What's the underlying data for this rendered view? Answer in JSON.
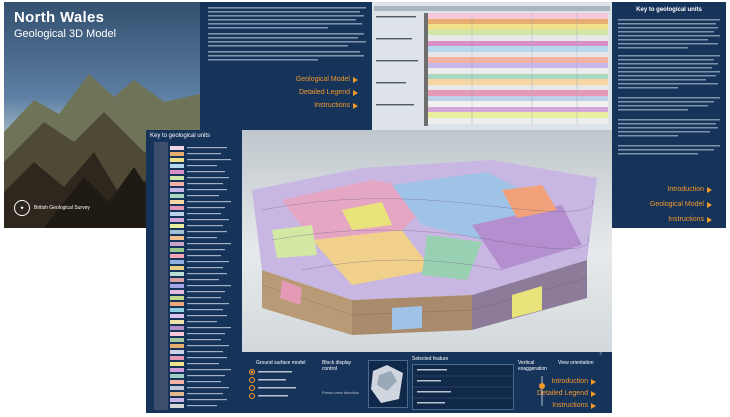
{
  "cover": {
    "title": "North Wales",
    "subtitle": "Geological 3D Model",
    "org_name": "British Geological Survey"
  },
  "intro": {
    "links": [
      "Geological Model",
      "Detailed Legend",
      "Instructions"
    ]
  },
  "key_panel": {
    "heading": "Key to geological units",
    "links": [
      "Introduction",
      "Geological Model",
      "Instructions"
    ]
  },
  "main": {
    "key_title": "Key to geological units",
    "controls": {
      "surface_model": "Ground surface model",
      "block_display": "Block display control",
      "selected_feature": "Selected feature",
      "vertical_exaggeration": "Vertical exaggeration",
      "view_orientation": "View orientation",
      "preset_view": "Preset view direction"
    },
    "links": [
      "Introduction",
      "Detailed Legend",
      "Instructions"
    ]
  },
  "colors": {
    "panel_navy": "#16335a",
    "link_orange": "#f39a2b",
    "legend_bg": "#dde3e8"
  }
}
